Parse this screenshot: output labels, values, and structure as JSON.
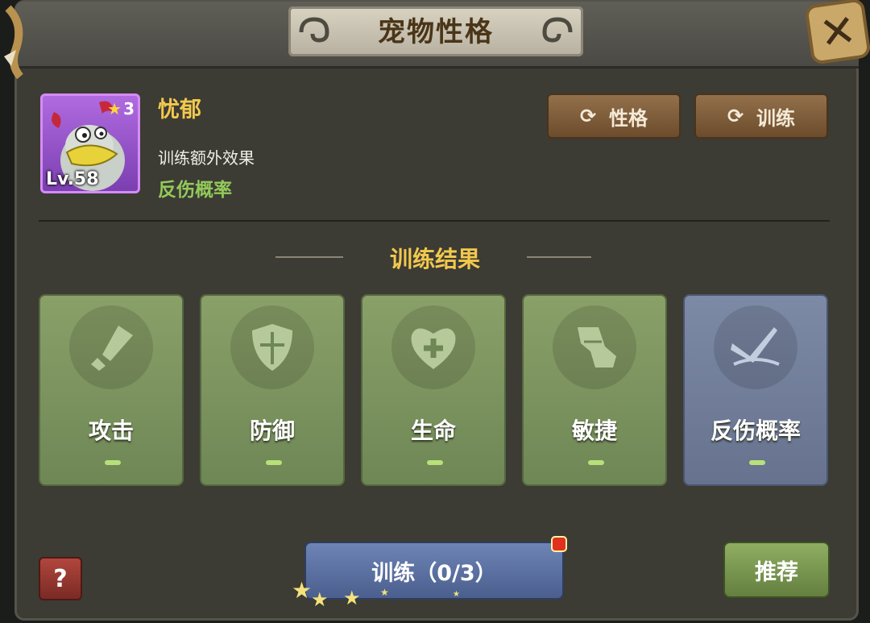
{
  "header": {
    "title": "宠物性格",
    "close_icon": "close-icon"
  },
  "pet": {
    "stars": "3",
    "level": "Lv.58",
    "name": "忧郁",
    "extra_label": "训练额外效果",
    "extra_effect": "反伤概率"
  },
  "actions": {
    "personality_label": "性格",
    "train_label": "训练"
  },
  "section": {
    "title": "训练结果"
  },
  "cards": [
    {
      "label": "攻击",
      "icon": "sword-icon",
      "color": "green"
    },
    {
      "label": "防御",
      "icon": "shield-icon",
      "color": "green"
    },
    {
      "label": "生命",
      "icon": "heart-plus-icon",
      "color": "green"
    },
    {
      "label": "敏捷",
      "icon": "boot-icon",
      "color": "green"
    },
    {
      "label": "反伤概率",
      "icon": "reflect-icon",
      "color": "blue"
    }
  ],
  "footer": {
    "help_label": "?",
    "train_button_label": "训练（0/3）",
    "recommend_label": "推荐"
  },
  "colors": {
    "accent_gold": "#f2c84e",
    "effect_green": "#93c95a",
    "card_green": "#7d9660",
    "card_blue": "#717e9a"
  }
}
